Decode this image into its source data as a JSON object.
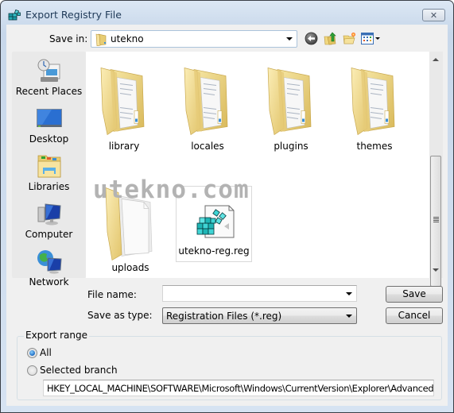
{
  "window": {
    "title": "Export Registry File",
    "close_label": "✕"
  },
  "toolbar": {
    "save_in_label": "Save in:",
    "save_in_value": "utekno",
    "icons": [
      "back-icon",
      "up-folder-icon",
      "new-folder-icon",
      "view-menu-icon"
    ]
  },
  "places": [
    {
      "label": "Recent Places",
      "icon": "recent-places-icon"
    },
    {
      "label": "Desktop",
      "icon": "desktop-icon"
    },
    {
      "label": "Libraries",
      "icon": "libraries-icon"
    },
    {
      "label": "Computer",
      "icon": "computer-icon"
    },
    {
      "label": "Network",
      "icon": "network-icon"
    }
  ],
  "files": [
    {
      "name": "library",
      "type": "folder"
    },
    {
      "name": "locales",
      "type": "folder"
    },
    {
      "name": "plugins",
      "type": "folder"
    },
    {
      "name": "themes",
      "type": "folder"
    },
    {
      "name": "uploads",
      "type": "empty-folder"
    },
    {
      "name": "utekno-reg.reg",
      "type": "reg-file"
    }
  ],
  "watermark": "utekno.com",
  "form": {
    "file_name_label": "File name:",
    "file_name_value": "",
    "save_as_type_label": "Save as type:",
    "save_as_type_value": "Registration Files (*.reg)",
    "save_label": "Save",
    "cancel_label": "Cancel"
  },
  "export_range": {
    "title": "Export range",
    "all_label": "All",
    "all_checked": true,
    "selected_branch_label": "Selected branch",
    "selected_branch_checked": false,
    "branch_value": "HKEY_LOCAL_MACHINE\\SOFTWARE\\Microsoft\\Windows\\CurrentVersion\\Explorer\\Advanced\\Folder"
  }
}
